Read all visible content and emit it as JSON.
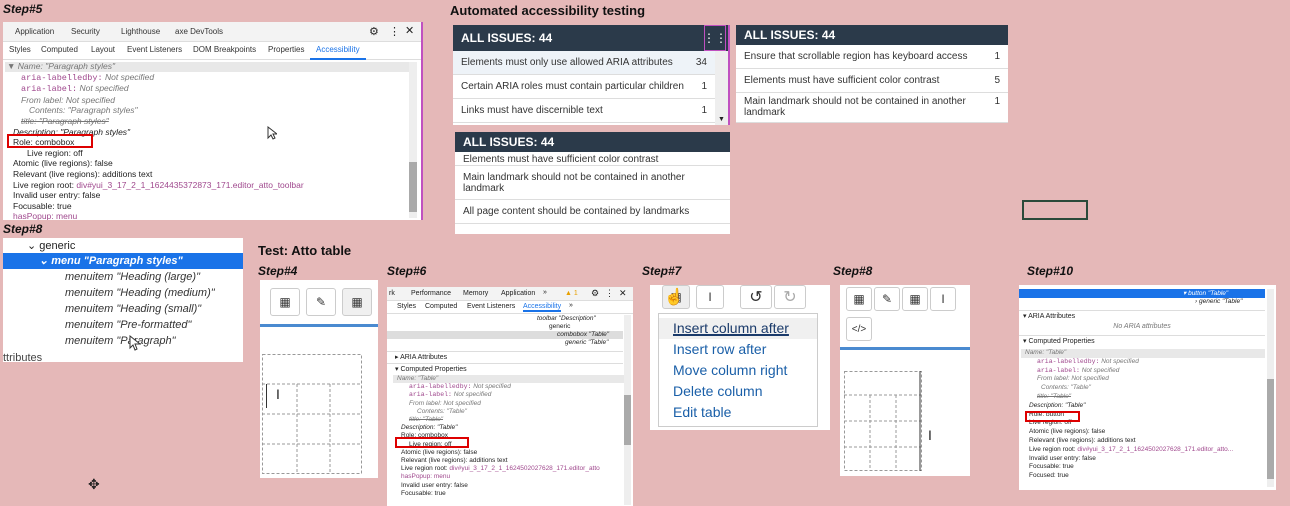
{
  "labels": {
    "step5": "Step#5",
    "automated": "Automated accessibility testing",
    "step8a": "Step#8",
    "test_atto": "Test: Atto table",
    "step4": "Step#4",
    "step6": "Step#6",
    "step7": "Step#7",
    "step8b": "Step#8",
    "step10": "Step#10"
  },
  "step5": {
    "top_tabs": [
      "Application",
      "Security",
      "Lighthouse",
      "axe DevTools"
    ],
    "sub_tabs": [
      "Styles",
      "Computed",
      "Layout",
      "Event Listeners",
      "DOM Breakpoints",
      "Properties",
      "Accessibility"
    ],
    "name_line": "▼ Name: \"Paragraph styles\"",
    "aria_labelledby": "aria-labelledby:",
    "aria_label": "aria-label:",
    "not_specified": "Not specified",
    "from_label": "From label: Not specified",
    "contents": "Contents: \"Paragraph styles\"",
    "title": "title: \"Paragraph styles\"",
    "description": "Description: \"Paragraph styles\"",
    "role": "Role: combobox",
    "live_region": "Live region: off",
    "atomic": "Atomic (live regions): false",
    "relevant": "Relevant (live regions): additions text",
    "live_root_label": "Live region root: ",
    "live_root_value": "div#yui_3_17_2_1_1624435372873_171",
    "live_root_suffix": ".editor_atto_toolbar",
    "invalid": "Invalid user entry: false",
    "focusable": "Focusable: true",
    "haspopup": "hasPopup: menu"
  },
  "step8a": {
    "generic": "generic",
    "menu": "menu \"Paragraph styles\"",
    "items": [
      "menuitem \"Heading (large)\"",
      "menuitem \"Heading (medium)\"",
      "menuitem \"Heading (small)\"",
      "menuitem \"Pre-formatted\"",
      "menuitem \"Paragraph\""
    ],
    "attributes": "ttributes"
  },
  "axe": {
    "header": "ALL ISSUES:",
    "count": "44",
    "panel1": [
      {
        "text": "Elements must only use allowed ARIA attributes",
        "n": "34"
      },
      {
        "text": "Certain ARIA roles must contain particular children",
        "n": "1"
      },
      {
        "text": "Links must have discernible text",
        "n": "1"
      }
    ],
    "panel2": [
      {
        "text": "Ensure that scrollable region has keyboard access",
        "n": "1"
      },
      {
        "text": "Elements must have sufficient color contrast",
        "n": "5"
      },
      {
        "text": "Main landmark should not be contained in another landmark",
        "n": "1"
      }
    ],
    "panel3": [
      {
        "text": "Elements must have sufficient color contrast",
        "n": ""
      },
      {
        "text": "Main landmark should not be contained in another landmark",
        "n": ""
      },
      {
        "text": "All page content should be contained by landmarks",
        "n": ""
      }
    ]
  },
  "step6": {
    "top_tabs": [
      "rk",
      "Performance",
      "Memory",
      "Application",
      "»"
    ],
    "warn": "▲ 1",
    "sub_tabs": [
      "Styles",
      "Computed",
      "Event Listeners",
      "Accessibility",
      "»"
    ],
    "tree": [
      "toolbar \"Description\"",
      "generic",
      "combobox \"Table\"",
      "generic \"Table\""
    ],
    "aria_section": "ARIA Attributes",
    "computed_section": "Computed Properties",
    "name_line": "Name: \"Table\"",
    "aria_labelledby": "aria-labelledby:",
    "aria_label": "aria-label:",
    "not_specified": "Not specified",
    "from_label": "From label: Not specified",
    "contents": "Contents: \"Table\"",
    "title": "title: \"Table\"",
    "description": "Description: \"Table\"",
    "role": "Role: combobox",
    "live_region": "Live region: off",
    "atomic": "Atomic (live regions): false",
    "relevant": "Relevant (live regions): additions text",
    "live_root_label": "Live region root: ",
    "live_root_value": "div#yui_3_17_2_1_1624502027628_171.editor_atto",
    "haspopup": "hasPopup: menu",
    "invalid": "Invalid user entry: false",
    "focusable": "Focusable: true"
  },
  "step7": {
    "menu": [
      "Insert column after",
      "Insert row after",
      "Move column right",
      "Delete column",
      "Edit table"
    ]
  },
  "step10": {
    "tree": [
      "button \"Table\"",
      "generic \"Table\""
    ],
    "aria_section": "ARIA Attributes",
    "no_aria": "No ARIA attributes",
    "computed_section": "Computed Properties",
    "name_line": "Name: \"Table\"",
    "aria_labelledby": "aria-labelledby:",
    "aria_label": "aria-label:",
    "not_specified": "Not specified",
    "from_label": "From label: Not specified",
    "contents": "Contents: \"Table\"",
    "title": "title: \"Table\"",
    "description": "Description: \"Table\"",
    "role": "Role: button",
    "live_region": "Live region: off",
    "atomic": "Atomic (live regions): false",
    "relevant": "Relevant (live regions): additions text",
    "live_root_label": "Live region root: ",
    "live_root_value": "div#yui_3_17_2_1_1624502027628_171.editor_atto...",
    "invalid": "Invalid user entry: false",
    "focusable": "Focusable: true",
    "focused": "Focused: true"
  }
}
